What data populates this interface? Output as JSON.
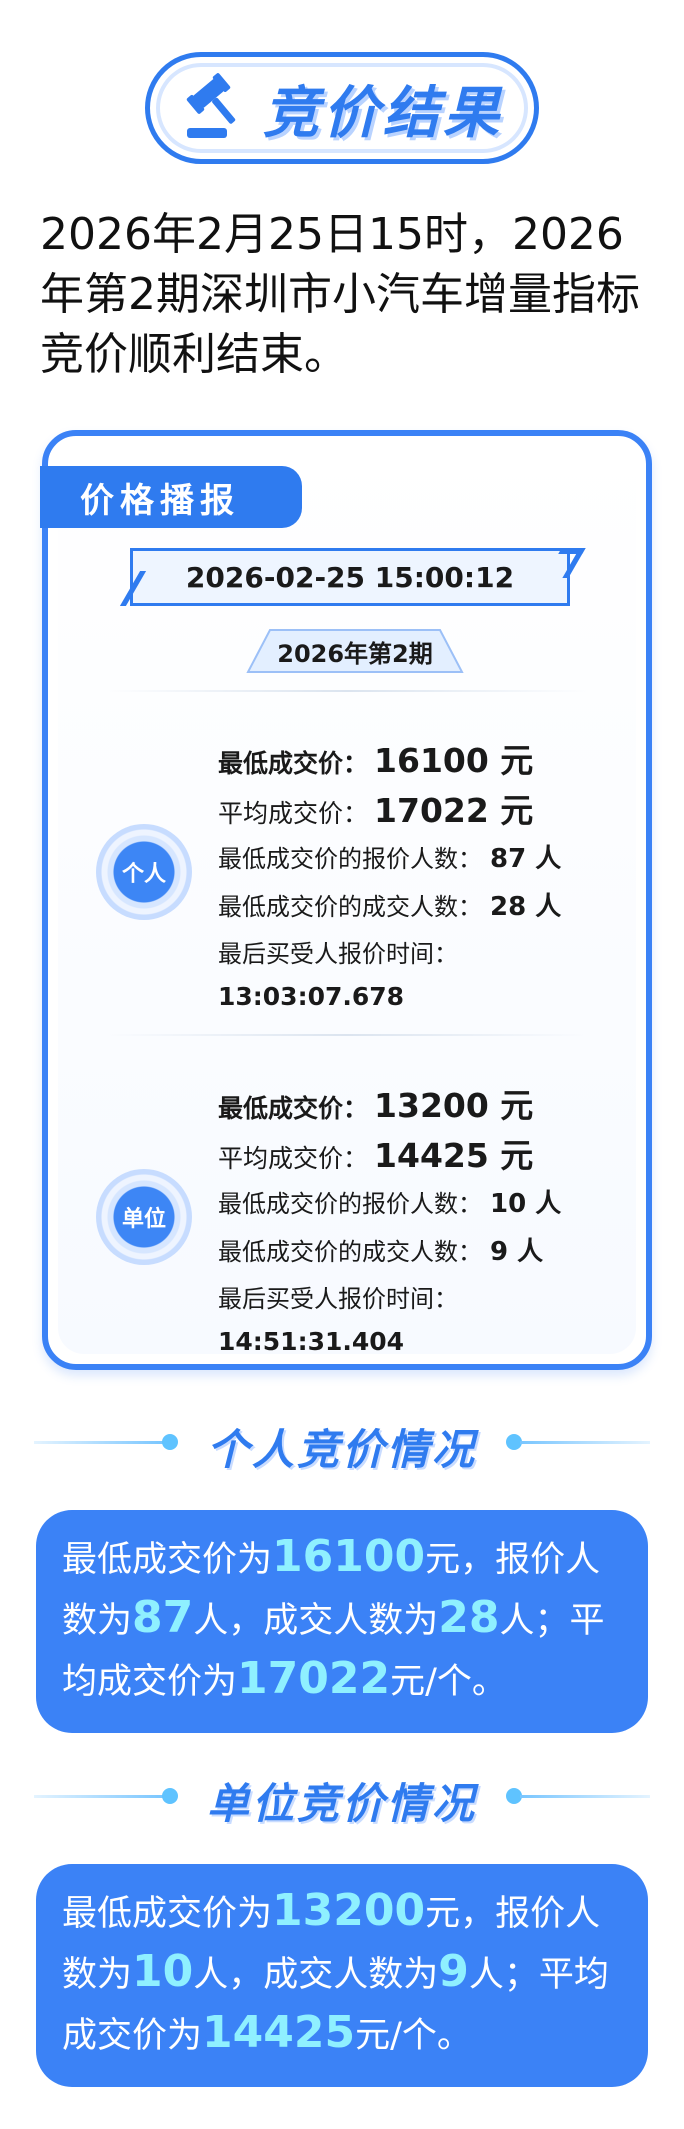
{
  "header": {
    "title": "竞价结果",
    "icon": "gavel-icon"
  },
  "intro": "2026年2月25日15时，2026年第2期深圳市小汽车增量指标竞价顺利结束。",
  "card": {
    "tab": "价格播报",
    "datetime": "2026-02-25 15:00:12",
    "period": "2026年第2期",
    "personal": {
      "badge": "个人",
      "lowest_label": "最低成交价：",
      "lowest_value": "16100 元",
      "avg_label": "平均成交价：",
      "avg_value": "17022 元",
      "bid_count_label": "最低成交价的报价人数：",
      "bid_count_value": "87 人",
      "deal_count_label": "最低成交价的成交人数：",
      "deal_count_value": "28 人",
      "last_time_label": "最后买受人报价时间：",
      "last_time_value": "13:03:07.678"
    },
    "company": {
      "badge": "单位",
      "lowest_label": "最低成交价：",
      "lowest_value": "13200 元",
      "avg_label": "平均成交价：",
      "avg_value": "14425 元",
      "bid_count_label": "最低成交价的报价人数：",
      "bid_count_value": "10 人",
      "deal_count_label": "最低成交价的成交人数：",
      "deal_count_value": "9 人",
      "last_time_label": "最后买受人报价时间：",
      "last_time_value": "14:51:31.404"
    }
  },
  "personal_section": {
    "title": "个人竞价情况",
    "t1": "最低成交价为",
    "v1": "16100",
    "t2": "元，报价人数为",
    "v2": "87",
    "t3": "人，成交人数为",
    "v3": "28",
    "t4": "人；平均成交价为",
    "v4": "17022",
    "t5": "元/个。"
  },
  "company_section": {
    "title": "单位竞价情况",
    "t1": "最低成交价为",
    "v1": "13200",
    "t2": "元，报价人数为",
    "v2": "10",
    "t3": "人，成交人数为",
    "v3": "9",
    "t4": "人；平均成交价为",
    "v4": "14425",
    "t5": "元/个。"
  },
  "colors": {
    "primary": "#2f7bef",
    "card_border": "#3b82f6",
    "highlight": "#8ff0ff",
    "accent_line": "#79c6ff"
  }
}
